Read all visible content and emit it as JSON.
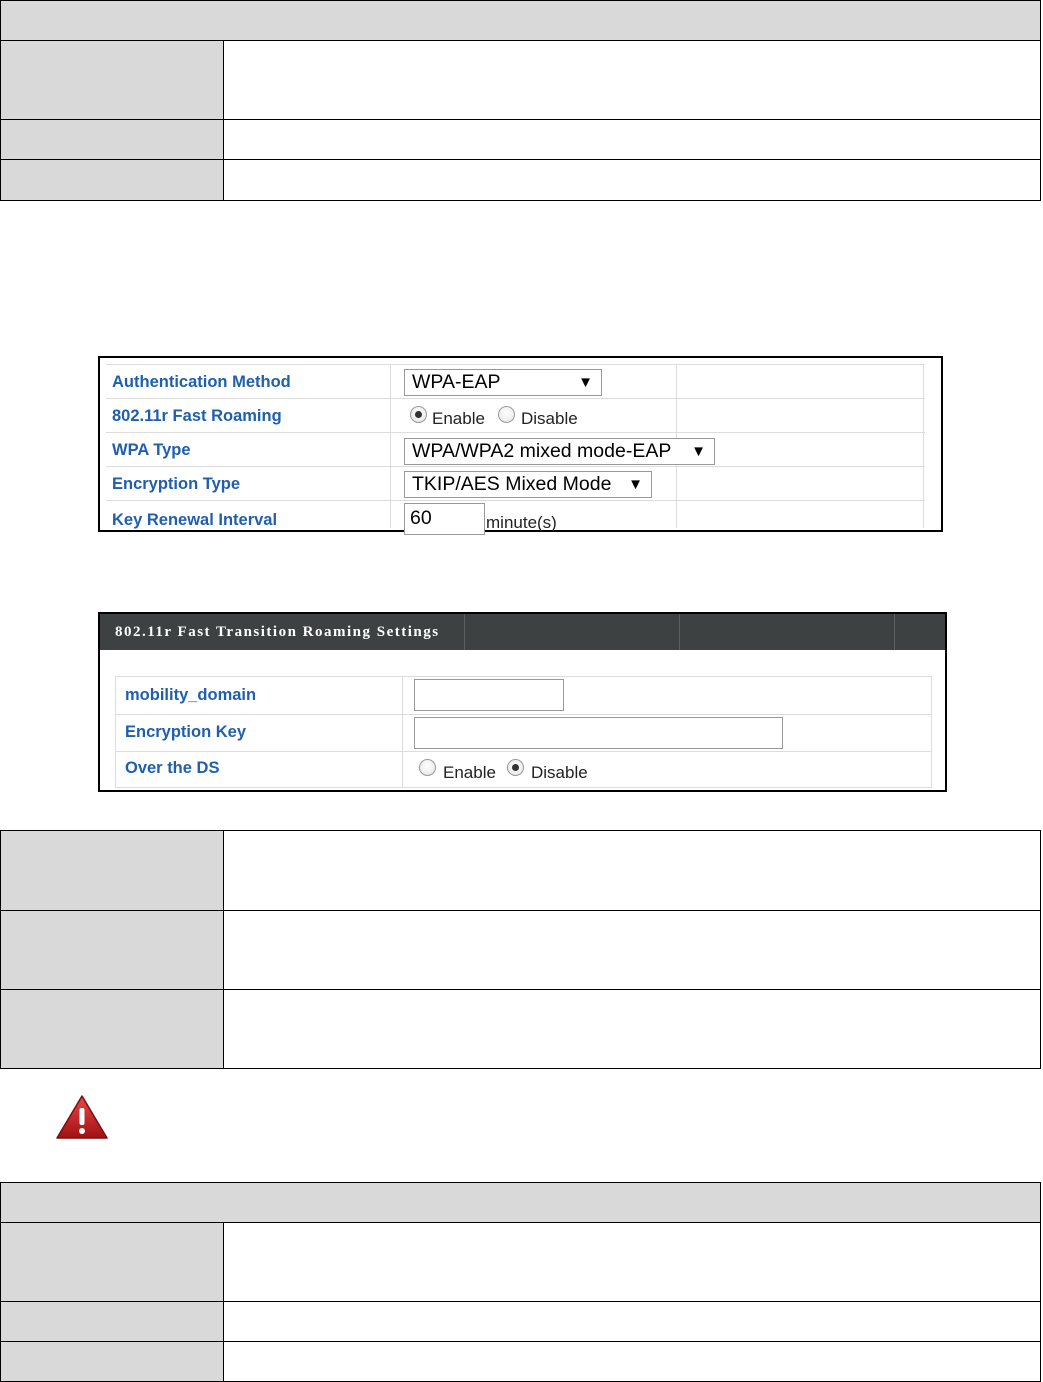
{
  "security_settings": {
    "authentication_method": {
      "label": "Authentication Method",
      "value": "WPA-EAP"
    },
    "fast_roaming": {
      "label": "802.11r Fast Roaming",
      "options": [
        "Enable",
        "Disable"
      ],
      "selected": "Enable"
    },
    "wpa_type": {
      "label": "WPA Type",
      "value": "WPA/WPA2 mixed mode-EAP"
    },
    "encryption_type": {
      "label": "Encryption Type",
      "value": "TKIP/AES Mixed Mode"
    },
    "key_renewal": {
      "label": "Key Renewal Interval",
      "value": "60",
      "unit": "minute(s)"
    }
  },
  "fast_transition": {
    "title": "802.11r Fast Transition Roaming Settings",
    "mobility_domain": {
      "label": "mobility_domain",
      "value": ""
    },
    "encryption_key": {
      "label": "Encryption Key",
      "value": ""
    },
    "over_the_ds": {
      "label": "Over the DS",
      "options": [
        "Enable",
        "Disable"
      ],
      "selected": "Disable"
    }
  },
  "dropdown_arrow": "▼",
  "icons": {
    "warning": "warning-triangle-icon"
  },
  "colors": {
    "label_blue": "#1f5fae",
    "header_dark": "#3d4141",
    "table_grey": "#d9d9d9"
  }
}
